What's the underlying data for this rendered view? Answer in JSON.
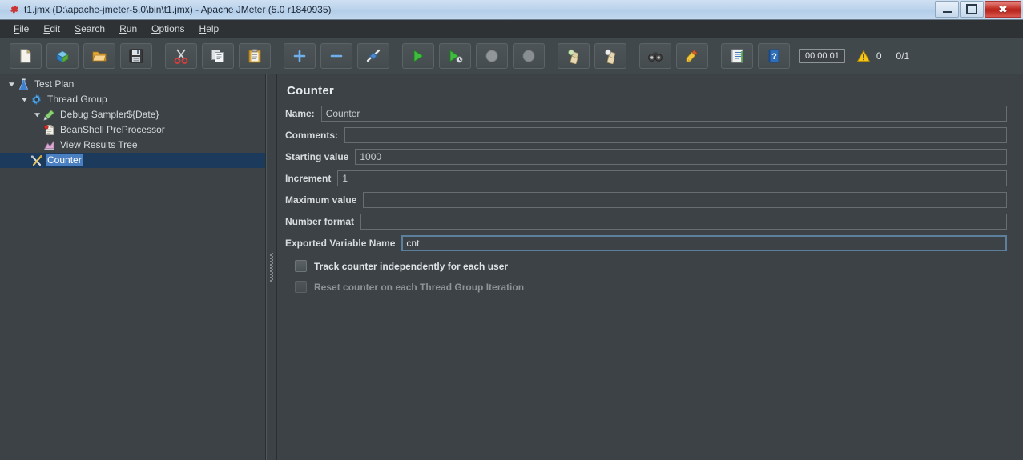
{
  "window": {
    "title": "t1.jmx (D:\\apache-jmeter-5.0\\bin\\t1.jmx) - Apache JMeter (5.0 r1840935)",
    "app_icon": "jmeter-feather-icon",
    "controls": {
      "minimize": "minimize-button",
      "maximize": "maximize-button",
      "close": "close-button"
    }
  },
  "menubar": {
    "items": [
      {
        "label": "File",
        "mnemonic": "F"
      },
      {
        "label": "Edit",
        "mnemonic": "E"
      },
      {
        "label": "Search",
        "mnemonic": "S"
      },
      {
        "label": "Run",
        "mnemonic": "R"
      },
      {
        "label": "Options",
        "mnemonic": "O"
      },
      {
        "label": "Help",
        "mnemonic": "H"
      }
    ]
  },
  "toolbar": {
    "buttons": [
      {
        "name": "new-test-plan-icon",
        "tooltip": "New"
      },
      {
        "name": "templates-icon",
        "tooltip": "Templates"
      },
      {
        "name": "open-icon",
        "tooltip": "Open"
      },
      {
        "name": "save-icon",
        "tooltip": "Save Test Plan"
      },
      {
        "name": "cut-icon",
        "tooltip": "Cut"
      },
      {
        "name": "copy-icon",
        "tooltip": "Copy"
      },
      {
        "name": "paste-icon",
        "tooltip": "Paste"
      },
      {
        "name": "expand-all-icon",
        "tooltip": "Expand All"
      },
      {
        "name": "collapse-all-icon",
        "tooltip": "Collapse All"
      },
      {
        "name": "toggle-icon",
        "tooltip": "Toggle"
      },
      {
        "name": "start-icon",
        "tooltip": "Start"
      },
      {
        "name": "start-no-timers-icon",
        "tooltip": "Start no pauses"
      },
      {
        "name": "stop-icon",
        "tooltip": "Stop"
      },
      {
        "name": "shutdown-icon",
        "tooltip": "Shutdown"
      },
      {
        "name": "clear-icon",
        "tooltip": "Clear"
      },
      {
        "name": "clear-all-icon",
        "tooltip": "Clear All"
      },
      {
        "name": "search-icon",
        "tooltip": "Search"
      },
      {
        "name": "reset-search-icon",
        "tooltip": "Reset Search"
      },
      {
        "name": "function-helper-icon",
        "tooltip": "Function Helper Dialog"
      },
      {
        "name": "help-icon",
        "tooltip": "Help"
      }
    ],
    "timer": "00:00:01",
    "warning_count": "0",
    "thread_counter": "0/1"
  },
  "tree": {
    "nodes": [
      {
        "label": "Test Plan",
        "icon": "test-plan-icon",
        "indent": 0,
        "expanded": true,
        "has_twisty": true,
        "selected": false
      },
      {
        "label": "Thread Group",
        "icon": "thread-group-icon",
        "indent": 1,
        "expanded": true,
        "has_twisty": true,
        "selected": false
      },
      {
        "label": "Debug Sampler${Date}",
        "icon": "debug-sampler-icon",
        "indent": 2,
        "expanded": true,
        "has_twisty": true,
        "selected": false
      },
      {
        "label": "BeanShell PreProcessor",
        "icon": "beanshell-preprocessor-icon",
        "indent": 3,
        "expanded": false,
        "has_twisty": false,
        "selected": false
      },
      {
        "label": "View Results Tree",
        "icon": "view-results-tree-icon",
        "indent": 3,
        "expanded": false,
        "has_twisty": false,
        "selected": false
      },
      {
        "label": "Counter",
        "icon": "counter-icon",
        "indent": 2,
        "expanded": false,
        "has_twisty": false,
        "selected": true
      }
    ]
  },
  "panel": {
    "title": "Counter",
    "fields": [
      {
        "label": "Name:",
        "value": "Counter",
        "focused": false
      },
      {
        "label": "Comments:",
        "value": "",
        "focused": false
      },
      {
        "label": "Starting value",
        "value": "1000",
        "focused": false
      },
      {
        "label": "Increment",
        "value": "1",
        "focused": false
      },
      {
        "label": "Maximum value",
        "value": "",
        "focused": false
      },
      {
        "label": "Number format",
        "value": "",
        "focused": false
      },
      {
        "label": "Exported Variable Name",
        "value": "cnt",
        "focused": true
      }
    ],
    "checkboxes": [
      {
        "label": "Track counter independently for each user",
        "checked": false,
        "disabled": false
      },
      {
        "label": "Reset counter on each Thread Group Iteration",
        "checked": false,
        "disabled": true
      }
    ]
  },
  "colors": {
    "titlebar": "#bcd4ec",
    "menubar": "#2e3235",
    "toolbar": "#41484b",
    "panel_bg": "#3c4245",
    "selection": "#4a7fc1",
    "selected_row": "#1b3a5c",
    "focus_border": "#5d7f9e",
    "text": "#d6d9db",
    "close_button": "#c33128"
  }
}
